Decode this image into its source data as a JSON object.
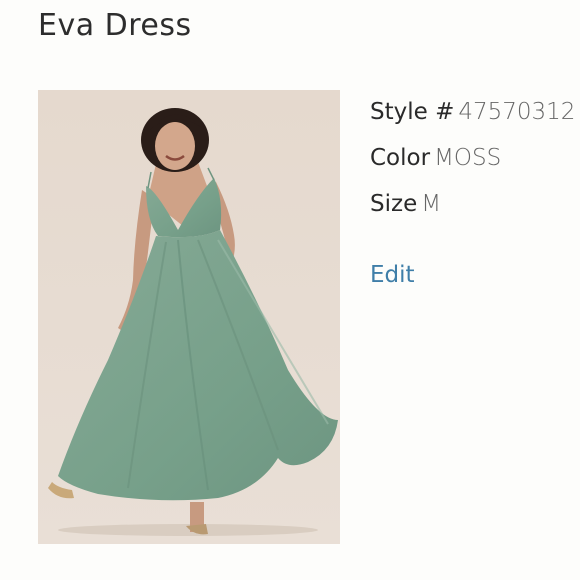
{
  "product": {
    "title": "Eva Dress",
    "photo_alt": "Eva Dress",
    "style_label": "Style #",
    "style_value": "47570312",
    "color_label": "Color",
    "color_value": "MOSS",
    "size_label": "Size",
    "size_value": "M",
    "edit_label": "Edit"
  },
  "colors": {
    "dress": "#7ea38e",
    "background": "#e6dbd1",
    "link": "#3f7ea8"
  },
  "icons": [
    "edit-link"
  ]
}
